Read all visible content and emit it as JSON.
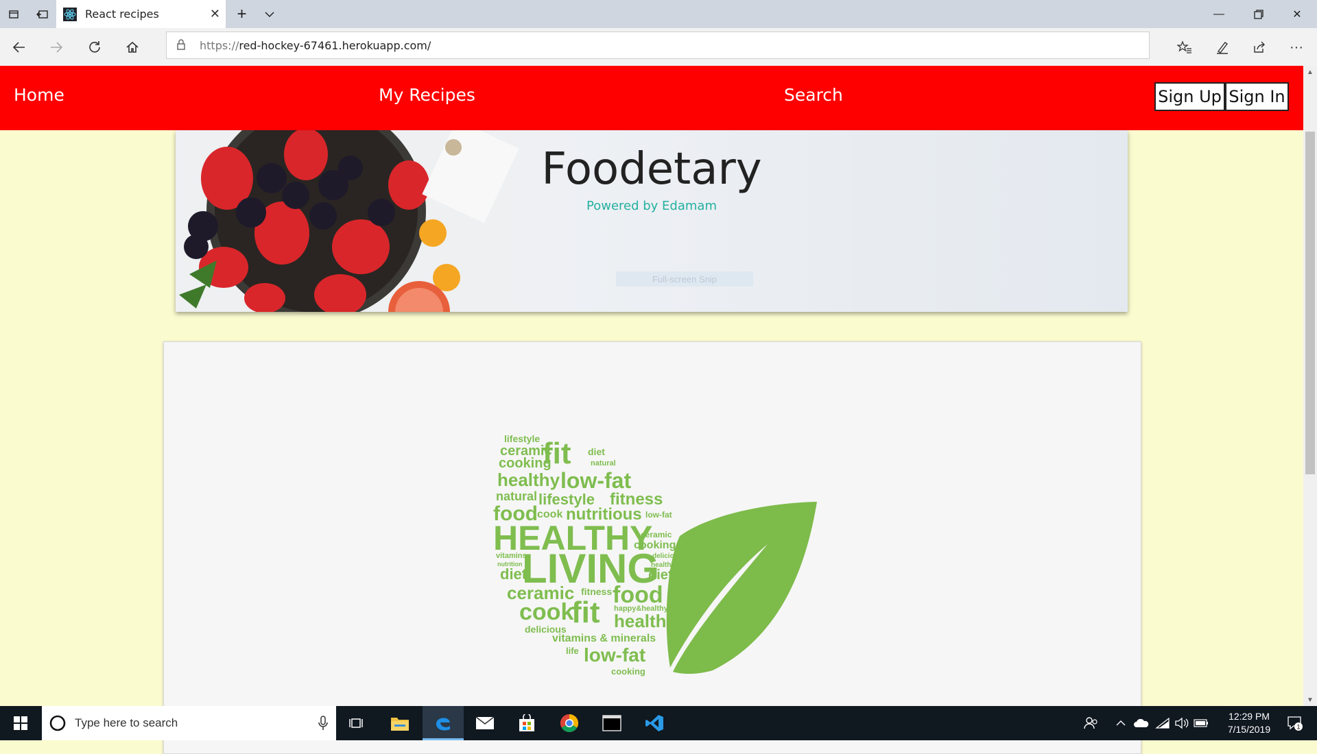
{
  "browser": {
    "tab_title": "React recipes",
    "url_scheme": "https://",
    "url_host": "red-hockey-67461.herokuapp.com/",
    "icons": [
      "tab-manager-icon",
      "tab-aside-icon",
      "close-icon",
      "plus-icon",
      "chevron-down-icon",
      "minimize-icon",
      "restore-icon",
      "close-window-icon",
      "back-icon",
      "forward-icon",
      "refresh-icon",
      "home-icon",
      "lock-icon",
      "favorites-icon",
      "pen-icon",
      "share-icon",
      "more-icon"
    ]
  },
  "nav": {
    "home": "Home",
    "my_recipes": "My Recipes",
    "search": "Search",
    "sign_up": "Sign Up",
    "sign_in": "Sign In"
  },
  "hero": {
    "title": "Foodetary",
    "subtitle": "Powered by Edamam",
    "snip_label": "Full-screen Snip"
  },
  "wordcloud": {
    "words": [
      "lifestyle",
      "ceramic",
      "fit",
      "diet",
      "cooking",
      "natural",
      "healthy",
      "low-fat",
      "natural",
      "lifestyle",
      "fitness",
      "food",
      "cook",
      "nutritious",
      "low-fat",
      "HEALTHY",
      "ceramic",
      "cooking",
      "vitamins",
      "delicious",
      "nutrition",
      "LIVING",
      "healthy",
      "diet",
      "diet",
      "ceramic",
      "fitness",
      "food",
      "cook",
      "fit",
      "happy&healthy",
      "health",
      "delicious",
      "vitamins & minerals",
      "life",
      "low-fat",
      "cooking"
    ],
    "leaf_color": "#7dbb4a"
  },
  "taskbar": {
    "search_placeholder": "Type here to search",
    "time": "12:29 PM",
    "date": "7/15/2019",
    "notification_count": "1"
  }
}
